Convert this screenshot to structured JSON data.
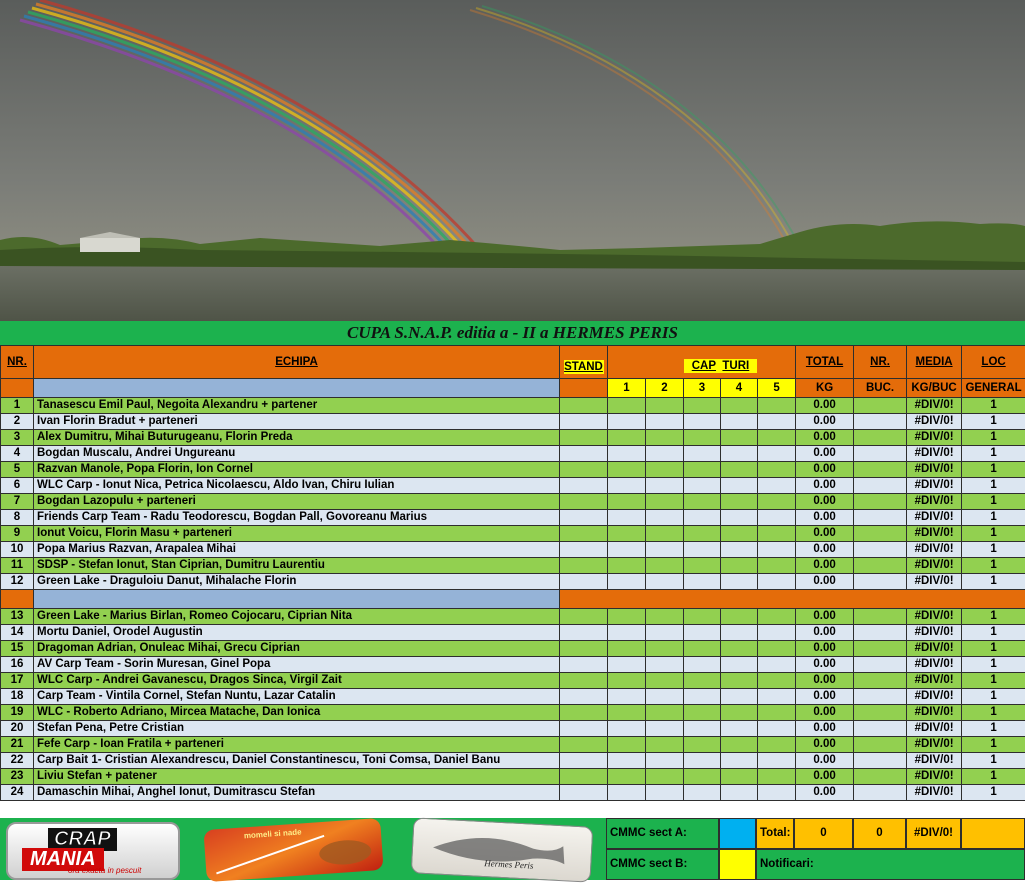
{
  "title": "CUPA S.N.A.P. editia a - II a  HERMES  PERIS",
  "header": {
    "nr": "NR.",
    "echipa": "ECHIPA",
    "stand": "STAND",
    "cap": "CAP",
    "turi": "TURI",
    "total": "TOTAL",
    "total_unit": "KG",
    "nr_buc": "NR.",
    "buc": "BUC.",
    "media": "MEDIA",
    "media_unit": "KG/BUC",
    "loc": "LOC",
    "general": "GENERAL",
    "rounds": [
      "1",
      "2",
      "3",
      "4",
      "5"
    ]
  },
  "rows": [
    {
      "nr": "1",
      "name": "Tanasescu Emil Paul, Negoita Alexandru + partener",
      "total": "0.00",
      "media": "#DIV/0!",
      "loc": "1"
    },
    {
      "nr": "2",
      "name": "Ivan Florin Bradut + parteneri",
      "total": "0.00",
      "media": "#DIV/0!",
      "loc": "1"
    },
    {
      "nr": "3",
      "name": "Alex Dumitru, Mihai Buturugeanu, Florin Preda",
      "total": "0.00",
      "media": "#DIV/0!",
      "loc": "1"
    },
    {
      "nr": "4",
      "name": "Bogdan Muscalu, Andrei Ungureanu",
      "total": "0.00",
      "media": "#DIV/0!",
      "loc": "1"
    },
    {
      "nr": "5",
      "name": "Razvan Manole, Popa Florin, Ion Cornel",
      "total": "0.00",
      "media": "#DIV/0!",
      "loc": "1"
    },
    {
      "nr": "6",
      "name": "WLC Carp - Ionut Nica, Petrica Nicolaescu, Aldo Ivan, Chiru Iulian",
      "total": "0.00",
      "media": "#DIV/0!",
      "loc": "1"
    },
    {
      "nr": "7",
      "name": "Bogdan Lazopulu + parteneri",
      "total": "0.00",
      "media": "#DIV/0!",
      "loc": "1"
    },
    {
      "nr": "8",
      "name": " Friends Carp Team - Radu Teodorescu, Bogdan Pall, Govoreanu Marius",
      "total": "0.00",
      "media": "#DIV/0!",
      "loc": "1"
    },
    {
      "nr": "9",
      "name": "Ionut Voicu, Florin Masu + parteneri",
      "total": "0.00",
      "media": "#DIV/0!",
      "loc": "1"
    },
    {
      "nr": "10",
      "name": "Popa Marius Razvan, Arapalea Mihai",
      "total": "0.00",
      "media": "#DIV/0!",
      "loc": "1"
    },
    {
      "nr": "11",
      "name": "SDSP - Stefan Ionut, Stan Ciprian, Dumitru Laurentiu",
      "total": "0.00",
      "media": "#DIV/0!",
      "loc": "1"
    },
    {
      "nr": "12",
      "name": "Green Lake - Draguloiu Danut, Mihalache Florin",
      "total": "0.00",
      "media": "#DIV/0!",
      "loc": "1"
    },
    {
      "nr": "13",
      "name": "Green Lake - Marius Birlan, Romeo Cojocaru, Ciprian Nita",
      "total": "0.00",
      "media": "#DIV/0!",
      "loc": "1"
    },
    {
      "nr": "14",
      "name": "Mortu Daniel, Orodel Augustin",
      "total": "0.00",
      "media": "#DIV/0!",
      "loc": "1"
    },
    {
      "nr": "15",
      "name": "Dragoman Adrian, Onuleac Mihai, Grecu Ciprian",
      "total": "0.00",
      "media": "#DIV/0!",
      "loc": "1"
    },
    {
      "nr": "16",
      "name": "AV Carp Team - Sorin Muresan, Ginel Popa",
      "total": "0.00",
      "media": "#DIV/0!",
      "loc": "1"
    },
    {
      "nr": "17",
      "name": "WLC Carp - Andrei Gavanescu, Dragos Sinca, Virgil Zait",
      "total": "0.00",
      "media": "#DIV/0!",
      "loc": "1"
    },
    {
      "nr": "18",
      "name": "Carp Team - Vintila Cornel, Stefan Nuntu, Lazar Catalin",
      "total": "0.00",
      "media": "#DIV/0!",
      "loc": "1"
    },
    {
      "nr": "19",
      "name": "WLC - Roberto Adriano, Mircea Matache, Dan Ionica",
      "total": "0.00",
      "media": "#DIV/0!",
      "loc": "1"
    },
    {
      "nr": "20",
      "name": "Stefan Pena, Petre Cristian",
      "total": "0.00",
      "media": "#DIV/0!",
      "loc": "1"
    },
    {
      "nr": "21",
      "name": "Fefe Carp - Ioan Fratila + parteneri",
      "total": "0.00",
      "media": "#DIV/0!",
      "loc": "1"
    },
    {
      "nr": "22",
      "name": "Carp Bait 1- Cristian Alexandrescu, Daniel Constantinescu, Toni Comsa, Daniel Banu",
      "total": "0.00",
      "media": "#DIV/0!",
      "loc": "1"
    },
    {
      "nr": "23",
      "name": "Liviu Stefan + patener",
      "total": "0.00",
      "media": "#DIV/0!",
      "loc": "1"
    },
    {
      "nr": "24",
      "name": "Damaschin Mihai, Anghel Ionut, Dumitrascu Stefan",
      "total": "0.00",
      "media": "#DIV/0!",
      "loc": "1"
    }
  ],
  "footer": {
    "cmmc_a": "CMMC sect A:",
    "cmmc_b": "CMMC sect B:",
    "total_label": "Total:",
    "total_kg": "0",
    "total_buc": "0",
    "total_media": "#DIV/0!",
    "notificari": "Notificari:",
    "logo1_line1": "CRAP",
    "logo1_line2": "MANIA",
    "logo1_tagline": "ora exacta in pescuit",
    "logo2_text": "momeli si nade",
    "logo3_text": "Hermes Peris",
    "colors": {
      "cmmc_a_swatch": "#00b0f0",
      "cmmc_b_swatch": "#ffff00",
      "total_bg": "#ffc000"
    }
  }
}
